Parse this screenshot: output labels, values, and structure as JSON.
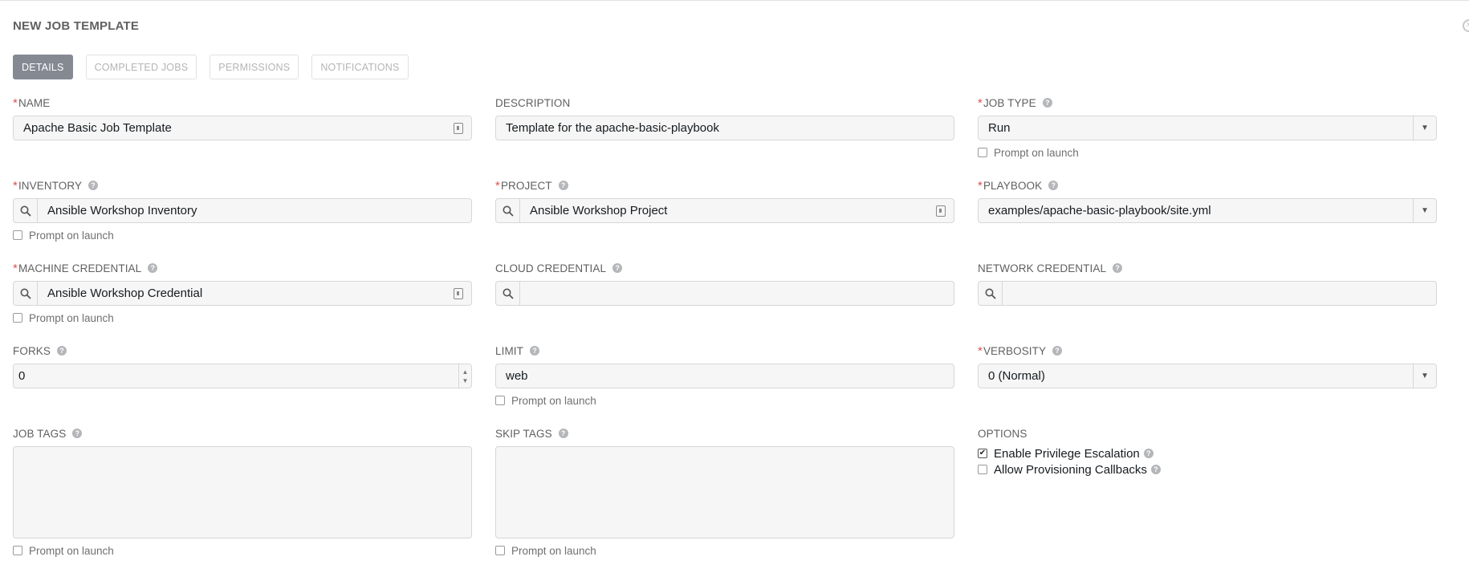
{
  "panel": {
    "title": "NEW JOB TEMPLATE"
  },
  "tabs": [
    {
      "label": "DETAILS",
      "active": true
    },
    {
      "label": "COMPLETED JOBS",
      "active": false
    },
    {
      "label": "PERMISSIONS",
      "active": false
    },
    {
      "label": "NOTIFICATIONS",
      "active": false
    }
  ],
  "prompt_label": "Prompt on launch",
  "fields": {
    "name": {
      "label": "NAME",
      "required": true,
      "value": "Apache Basic Job Template"
    },
    "description": {
      "label": "DESCRIPTION",
      "required": false,
      "value": "Template for the apache-basic-playbook"
    },
    "job_type": {
      "label": "JOB TYPE",
      "required": true,
      "value": "Run"
    },
    "inventory": {
      "label": "INVENTORY",
      "required": true,
      "value": "Ansible Workshop Inventory"
    },
    "project": {
      "label": "PROJECT",
      "required": true,
      "value": "Ansible Workshop Project"
    },
    "playbook": {
      "label": "PLAYBOOK",
      "required": true,
      "value": "examples/apache-basic-playbook/site.yml"
    },
    "machine_credential": {
      "label": "MACHINE CREDENTIAL",
      "required": true,
      "value": "Ansible Workshop Credential"
    },
    "cloud_credential": {
      "label": "CLOUD CREDENTIAL",
      "required": false,
      "value": ""
    },
    "network_credential": {
      "label": "NETWORK CREDENTIAL",
      "required": false,
      "value": ""
    },
    "forks": {
      "label": "FORKS",
      "required": false,
      "value": "0"
    },
    "limit": {
      "label": "LIMIT",
      "required": false,
      "value": "web"
    },
    "verbosity": {
      "label": "VERBOSITY",
      "required": true,
      "value": "0 (Normal)"
    },
    "job_tags": {
      "label": "JOB TAGS",
      "required": false,
      "value": ""
    },
    "skip_tags": {
      "label": "SKIP TAGS",
      "required": false,
      "value": ""
    }
  },
  "options": {
    "label": "OPTIONS",
    "items": [
      {
        "label": "Enable Privilege Escalation",
        "checked": true
      },
      {
        "label": "Allow Provisioning Callbacks",
        "checked": false
      }
    ]
  },
  "icons": {
    "search": "search-icon",
    "key": "key-icon",
    "help": "help-icon",
    "caret": "chevron-down-icon",
    "close": "close-icon"
  },
  "colors": {
    "required": "#d9534f",
    "active_tab": "#848992",
    "input_bg": "#f6f6f6"
  }
}
